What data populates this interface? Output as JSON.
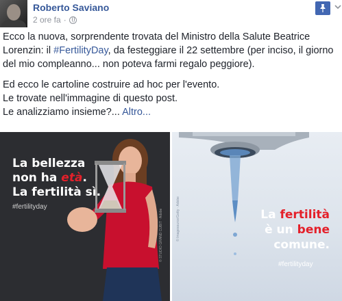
{
  "post": {
    "author": "Roberto Saviano",
    "timestamp": "2 ore fa",
    "separator": "·",
    "privacy_icon": "globe-icon",
    "pin_icon": "pin-icon",
    "options_icon": "chevron-down-icon",
    "lines": {
      "l1": "Ecco la nuova, sorprendente trovata del Ministro della Salute Beatrice",
      "l2a": "Lorenzin: il ",
      "l2_hashtag": "#FertilityDay",
      "l2b": ", da festeggiare il 22 settembre (per inciso, il giorno",
      "l3": "del mio compleanno... non poteva farmi regalo peggiore).",
      "l4": "Ed ecco le cartoline costruire ad hoc per l'evento.",
      "l5": "Le trovate nell'immagine di questo post.",
      "l6": "Le analizziamo insieme?...",
      "more": " Altro..."
    }
  },
  "image_left": {
    "line1": "La bellezza",
    "line2a": "non ha ",
    "line2_red": "età",
    "line2b": ".",
    "line3": "La fertilità sì.",
    "hashtag": "#fertilityday",
    "credit": "© STUDIO GRAND CUBIT · Adobe"
  },
  "image_right": {
    "line1a": "La ",
    "line1_red": "fertilità",
    "line2a": "è un ",
    "line2_red": "bene",
    "line3": "comune.",
    "hashtag": "#fertilityday",
    "credit": "© Imagesource/Getty · Adobe"
  },
  "colors": {
    "link": "#365899",
    "accent_button": "#4267b2",
    "poster_red": "#e4202a"
  }
}
